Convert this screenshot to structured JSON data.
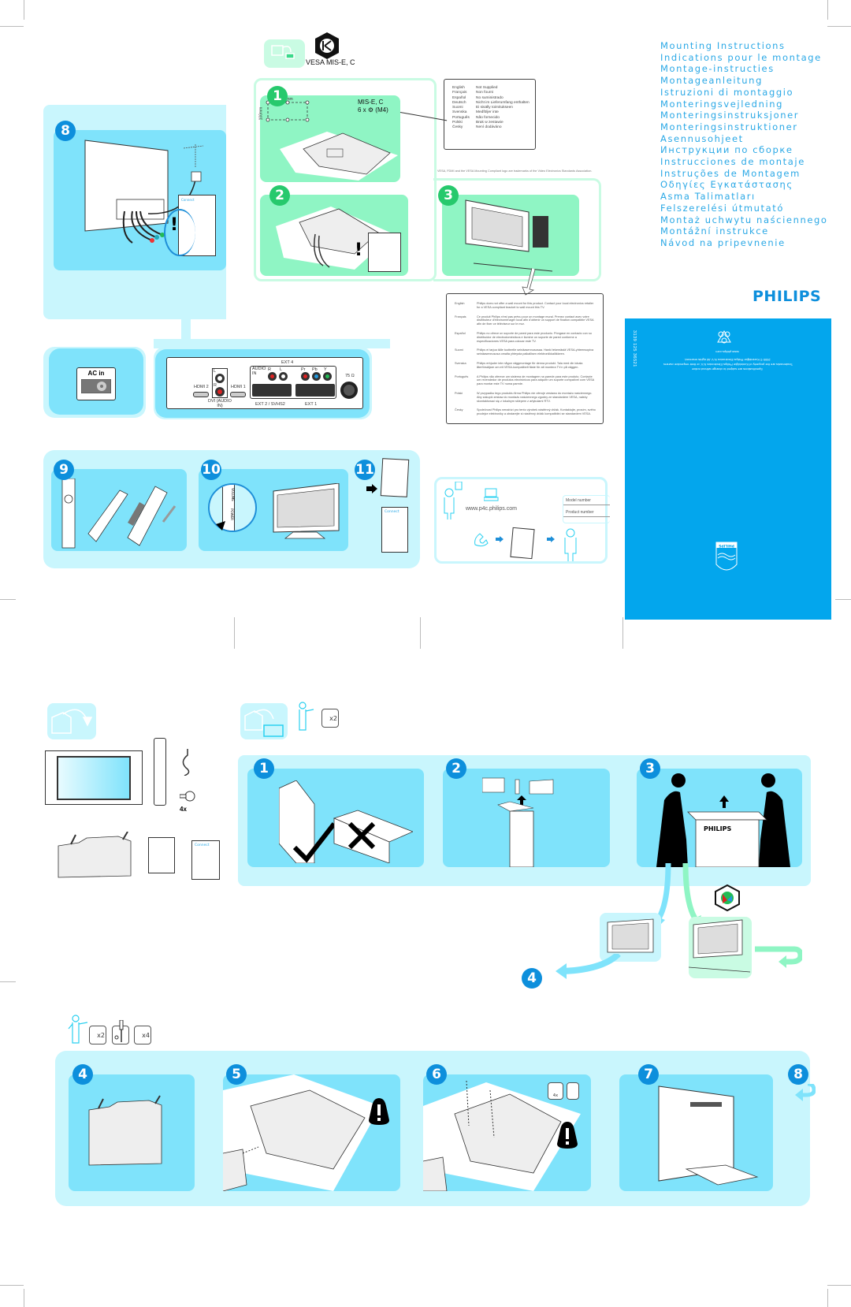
{
  "document": {
    "brand": "PHILIPS",
    "titles": [
      "Mounting Instructions",
      "Indications pour le montage",
      "Montage-instructies",
      "Montageanleitung",
      "Istruzioni di montaggio",
      "Monteringsvejledning",
      "Monteringsinstruksjoner",
      "Monteringsinstruktioner",
      "Asennusohjeet",
      "Инструкции по сборке",
      "Instrucciones de montaje",
      "Instruções de Montagem",
      "Οδηγίες Εγκατάστασης",
      "Asma Talimatları",
      "Felszerelési útmutató",
      "Montaż uchwytu naściennego",
      "Montážní instrukce",
      "Návod na pripevnenie"
    ]
  },
  "vesa": {
    "logo_label": "VESA MIS-E, C",
    "spec_line1": "MIS-E, C",
    "spec_line2": "6 x ⚙ (M4)",
    "dim_horizontal": "200mm",
    "dim_vertical": "100mm",
    "trademark_note": "VESA, FDMI and the VESA Mounting Compliant logo are trademarks of the Video Electronics Standards Association.",
    "not_supplied": [
      {
        "lang": "English",
        "text": "Not Supplied"
      },
      {
        "lang": "Français",
        "text": "Non fourni"
      },
      {
        "lang": "Español",
        "text": "No suministrado"
      },
      {
        "lang": "Deutsch",
        "text": "Nicht im Lieferumfang enthalten"
      },
      {
        "lang": "Suomi",
        "text": "Ei sisälly toimitukseen"
      },
      {
        "lang": "Svenska",
        "text": "Medföljer inte"
      },
      {
        "lang": "Português",
        "text": "Não fornecido"
      },
      {
        "lang": "Polski",
        "text": "Brak w zestawie"
      },
      {
        "lang": "Česky",
        "text": "Není dodáváno"
      }
    ],
    "wall_mount_notes": [
      {
        "lang": "English",
        "text": "Philips does not offer a wall mount for this product. Contact your local electronics retailer for a VESA compliant bracket to wall mount this TV."
      },
      {
        "lang": "Français",
        "text": "Ce produit Philips n'est pas prévu pour un montage mural. Prenez contact avec votre distributeur d'électroménager local afin d'obtenir un support de fixation compatible VESA afin de fixer ce téléviseur sur le mur."
      },
      {
        "lang": "Español",
        "text": "Philips no ofrece un soporte de pared para este producto. Póngase en contacto con su distribuidor de electrodomésticos e ilumine un soporte de pared conforme a especificaciones VESA para colocar este TV."
      },
      {
        "lang": "Suomi",
        "text": "Philips ei tarjoa tälle tuotteelle seinäasennusosaa. Hanki tekemästä VESA-yhteensopiva seinäasennusosa omalta yhteysta paikallisen elektroniikkaliikkeen."
      },
      {
        "lang": "Svenska",
        "text": "Philips erbjuder inte någon väggmontage för denna produkt. Tala med din lokala återförsäljare om ett VESA-kompatibelt fäste för att montera TV:n på väggen."
      },
      {
        "lang": "Português",
        "text": "A Philips não oferece um sistema de montagem na parede para este produto. Contacte um revendedor de produtos electrónicos para adquirir um suporte compatível com VESA para montar este TV numa parede."
      },
      {
        "lang": "Polski",
        "text": "W przypadku tego produktu firma Philips nie oferuje zestawu do montażu naściennego. Aby zakupić zestaw do montażu naściennego zgodny ze standardem VESA, należy skontaktować się z lokalnym sklepem z artykułami RTV."
      },
      {
        "lang": "Česky",
        "text": "Společnost Philips nenabízí pro tento výrobek nástěnný držák. Kontaktujte, prosím, svého prodejce elektroniky a obstarejte si nástěnný držák kompatibilní se standardem VESA."
      }
    ]
  },
  "connections": {
    "ac_in": "AC in",
    "hdmi2": "HDMI 2",
    "hdmi1": "HDMI 1",
    "dvi_audio": "DVI (AUDIO IN)",
    "audio_in": "AUDIO IN",
    "audio_r": "R",
    "audio_l": "L",
    "ext4": "EXT 4",
    "pr": "Pr",
    "pb": "Pb",
    "y": "Y",
    "ext2": "EXT 2 / SVHS2",
    "ext1": "EXT 1",
    "antenna": "75 Ω",
    "dvi_l": "L",
    "dvi_r": "R"
  },
  "steps_top": {
    "s1": "1",
    "s2": "2",
    "s3": "3",
    "s8": "8",
    "s9": "9",
    "s10": "10",
    "s11": "11",
    "connect_card": "Connect",
    "power_label": "POWER",
    "volume_label": "VOLUME"
  },
  "support": {
    "website": "www.p4c.philips.com",
    "model_number": "Model number",
    "product_number": "Product number"
  },
  "cover": {
    "doc_number": "3139 125 36521",
    "website": "www.philips.com",
    "copyright": "2005 © Koninklijke Philips Electronics N.V. All rights reserved.",
    "specs_notice": "Specifications are subject to change without notice",
    "trademark_notice": "Trademarks are the property of Koninklijke Philips Electronics N.V. or their respective owners",
    "shield_label": "PHILIPS"
  },
  "unpacking": {
    "people_count": "x2",
    "screws_count": "4x",
    "steps": [
      "1",
      "2",
      "3",
      "4"
    ],
    "box_brand": "PHILIPS",
    "connect_card": "Connect"
  },
  "assembly": {
    "people_count": "x2",
    "screw_count": "x4",
    "screw_count_step6": "4x",
    "steps": [
      "4",
      "5",
      "6",
      "7",
      "8"
    ]
  },
  "colors": {
    "title_blue": "#2aa8e6",
    "brand_blue": "#0d8fdc",
    "cover_blue": "#03a6ed",
    "panel_pale": "#c9f6fd",
    "panel_mid": "#7fe3fb",
    "mint": "#8ff5c4"
  }
}
